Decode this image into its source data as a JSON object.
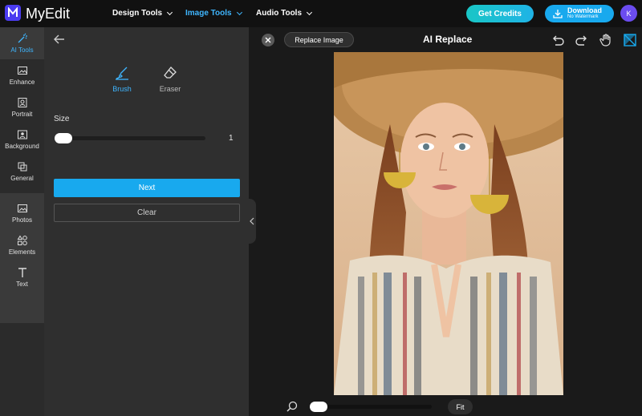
{
  "app": {
    "brand": "MyEdit"
  },
  "topnav": [
    {
      "label": "Design Tools"
    },
    {
      "label": "Image Tools"
    },
    {
      "label": "Audio Tools"
    }
  ],
  "header": {
    "credits_label": "Get Credits",
    "download_label": "Download",
    "download_sub": "No Watermark",
    "avatar_initial": "K"
  },
  "sidebar": {
    "items": [
      {
        "label": "AI Tools",
        "icon": "wand-icon"
      },
      {
        "label": "Enhance",
        "icon": "enhance-icon"
      },
      {
        "label": "Portrait",
        "icon": "portrait-icon"
      },
      {
        "label": "Background",
        "icon": "background-icon"
      },
      {
        "label": "General",
        "icon": "crop-icon"
      },
      {
        "label": "Photos",
        "icon": "photos-icon"
      },
      {
        "label": "Elements",
        "icon": "elements-icon"
      },
      {
        "label": "Text",
        "icon": "text-icon"
      }
    ]
  },
  "panel": {
    "tools": [
      {
        "label": "Brush"
      },
      {
        "label": "Eraser"
      }
    ],
    "size_label": "Size",
    "size_value": "1",
    "size_fraction": 0.0,
    "next_label": "Next",
    "clear_label": "Clear"
  },
  "canvas": {
    "replace_label": "Replace Image",
    "title": "AI Replace",
    "fit_label": "Fit",
    "zoom_fraction": 0.0
  },
  "colors": {
    "accent": "#18a9ee",
    "active_text": "#3fb6ff",
    "brand": "#4b3cf0"
  }
}
